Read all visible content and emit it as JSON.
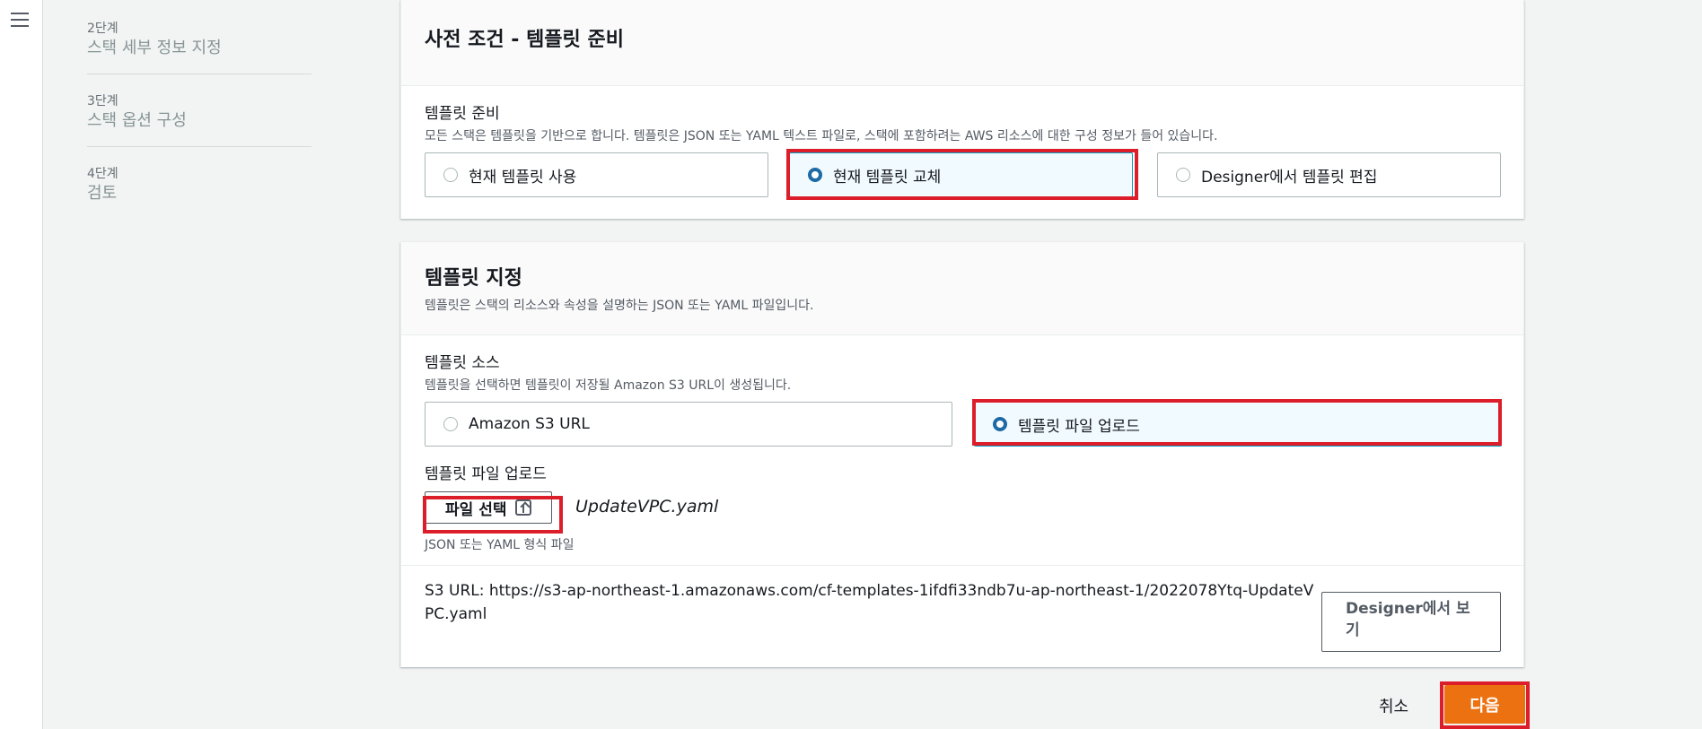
{
  "nav": {
    "menu_icon": "hamburger-menu-icon"
  },
  "steps": [
    {
      "num": "2단계",
      "title": "스택 세부 정보 지정"
    },
    {
      "num": "3단계",
      "title": "스택 옵션 구성"
    },
    {
      "num": "4단계",
      "title": "검토"
    }
  ],
  "prereq": {
    "title": "사전 조건 - 템플릿 준비",
    "field_label": "템플릿 준비",
    "field_desc": "모든 스택은 템플릿을 기반으로 합니다. 템플릿은 JSON 또는 YAML 텍스트 파일로, 스택에 포함하려는 AWS 리소스에 대한 구성 정보가 들어 있습니다.",
    "options": [
      {
        "label": "현재 템플릿 사용",
        "selected": false
      },
      {
        "label": "현재 템플릿 교체",
        "selected": true
      },
      {
        "label": "Designer에서 템플릿 편집",
        "selected": false
      }
    ]
  },
  "template": {
    "title": "템플릿 지정",
    "desc": "템플릿은 스택의 리소스와 속성을 설명하는 JSON 또는 YAML 파일입니다.",
    "source_label": "템플릿 소스",
    "source_desc": "템플릿을 선택하면 템플릿이 저장될 Amazon S3 URL이 생성됩니다.",
    "source_options": [
      {
        "label": "Amazon S3 URL",
        "selected": false
      },
      {
        "label": "템플릿 파일 업로드",
        "selected": true
      }
    ],
    "upload_label": "템플릿 파일 업로드",
    "choose_file_label": "파일 선택",
    "file_name": "UpdateVPC.yaml",
    "file_hint": "JSON 또는 YAML 형식 파일",
    "s3_url_text": "S3 URL:  https://s3-ap-northeast-1.amazonaws.com/cf-templates-1ifdfi33ndb7u-ap-northeast-1/2022078Ytq-UpdateVPC.yaml",
    "designer_view_label": "Designer에서 보기"
  },
  "footer": {
    "cancel_label": "취소",
    "next_label": "다음"
  },
  "colors": {
    "accent": "#ec7211",
    "selected_radio": "#1d6aa5",
    "highlight_box": "#dc1e2a"
  }
}
